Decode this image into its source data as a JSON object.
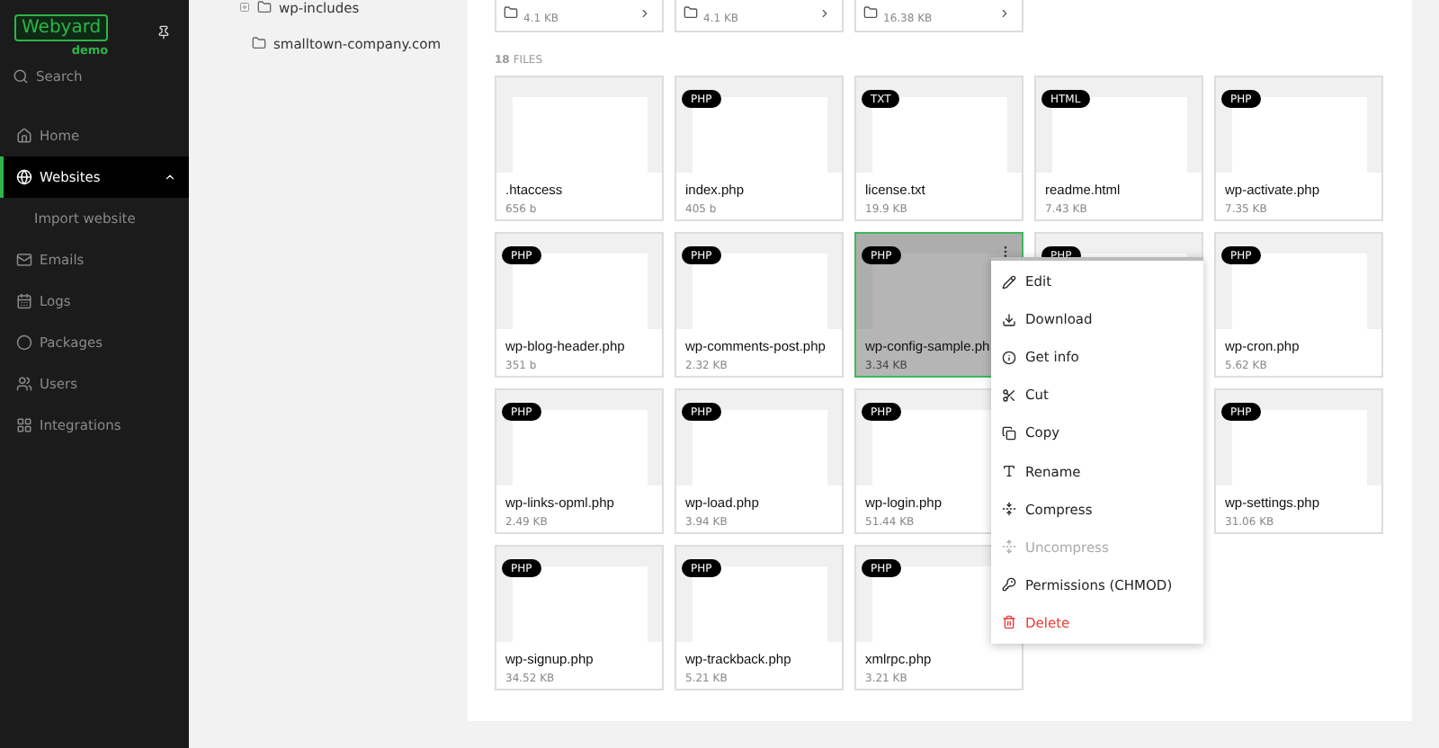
{
  "sidebar": {
    "logo": "Webyard",
    "edition": "demo",
    "search": {
      "placeholder": "Search"
    },
    "items": [
      {
        "label": "Home",
        "selected": false
      },
      {
        "label": "Websites",
        "selected": true,
        "expanded": true,
        "children": [
          {
            "label": "Import website"
          }
        ]
      },
      {
        "label": "Emails",
        "selected": false
      },
      {
        "label": "Logs",
        "selected": false
      },
      {
        "label": "Packages",
        "selected": false
      },
      {
        "label": "Users",
        "selected": false
      },
      {
        "label": "Integrations",
        "selected": false
      }
    ]
  },
  "tree": [
    {
      "label": "wp-includes",
      "expanded": false
    },
    {
      "label": "smalltown-company.com"
    }
  ],
  "folders": [
    {
      "size": "4.1 KB"
    },
    {
      "size": "4.1 KB"
    },
    {
      "size": "16.38 KB"
    }
  ],
  "files_count": {
    "count": "18",
    "label": "FILES"
  },
  "files": [
    {
      "name": ".htaccess",
      "size": "656 b",
      "selected": false
    },
    {
      "name": "index.php",
      "size": "405 b",
      "badge": "PHP",
      "selected": false
    },
    {
      "name": "license.txt",
      "size": "19.9 KB",
      "badge": "TXT",
      "selected": false
    },
    {
      "name": "readme.html",
      "size": "7.43 KB",
      "badge": "HTML",
      "selected": false
    },
    {
      "name": "wp-activate.php",
      "size": "7.35 KB",
      "badge": "PHP",
      "selected": false
    },
    {
      "name": "wp-blog-header.php",
      "size": "351 b",
      "badge": "PHP",
      "selected": false
    },
    {
      "name": "wp-comments-post.php",
      "size": "2.32 KB",
      "badge": "PHP",
      "selected": false
    },
    {
      "name": "wp-config-sample.ph",
      "size": "3.34 KB",
      "badge": "PHP",
      "selected": true
    },
    {
      "badge": "PHP",
      "selected": false
    },
    {
      "name": "wp-cron.php",
      "size": "5.62 KB",
      "badge": "PHP",
      "selected": false
    },
    {
      "name": "wp-links-opml.php",
      "size": "2.49 KB",
      "badge": "PHP",
      "selected": false
    },
    {
      "name": "wp-load.php",
      "size": "3.94 KB",
      "badge": "PHP",
      "selected": false
    },
    {
      "name": "wp-login.php",
      "size": "51.44 KB",
      "badge": "PHP",
      "selected": false
    },
    {
      "name": "wp-settings.php",
      "size": "31.06 KB",
      "badge": "PHP",
      "selected": false
    },
    {
      "name": "wp-signup.php",
      "size": "34.52 KB",
      "badge": "PHP",
      "selected": false
    },
    {
      "name": "wp-trackback.php",
      "size": "5.21 KB",
      "badge": "PHP",
      "selected": false
    },
    {
      "name": "xmlrpc.php",
      "size": "3.21 KB",
      "badge": "PHP",
      "selected": false
    }
  ],
  "context_menu": [
    {
      "label": "Edit",
      "disabled": false,
      "danger": false
    },
    {
      "label": "Download",
      "disabled": false,
      "danger": false
    },
    {
      "label": "Get info",
      "disabled": false,
      "danger": false
    },
    {
      "label": "Cut",
      "disabled": false,
      "danger": false
    },
    {
      "label": "Copy",
      "disabled": false,
      "danger": false
    },
    {
      "label": "Rename",
      "disabled": false,
      "danger": false
    },
    {
      "label": "Compress",
      "disabled": false,
      "danger": false
    },
    {
      "label": "Uncompress",
      "disabled": true,
      "danger": false
    },
    {
      "label": "Permissions (CHMOD)",
      "disabled": false,
      "danger": false
    },
    {
      "label": "Delete",
      "disabled": false,
      "danger": true
    }
  ]
}
